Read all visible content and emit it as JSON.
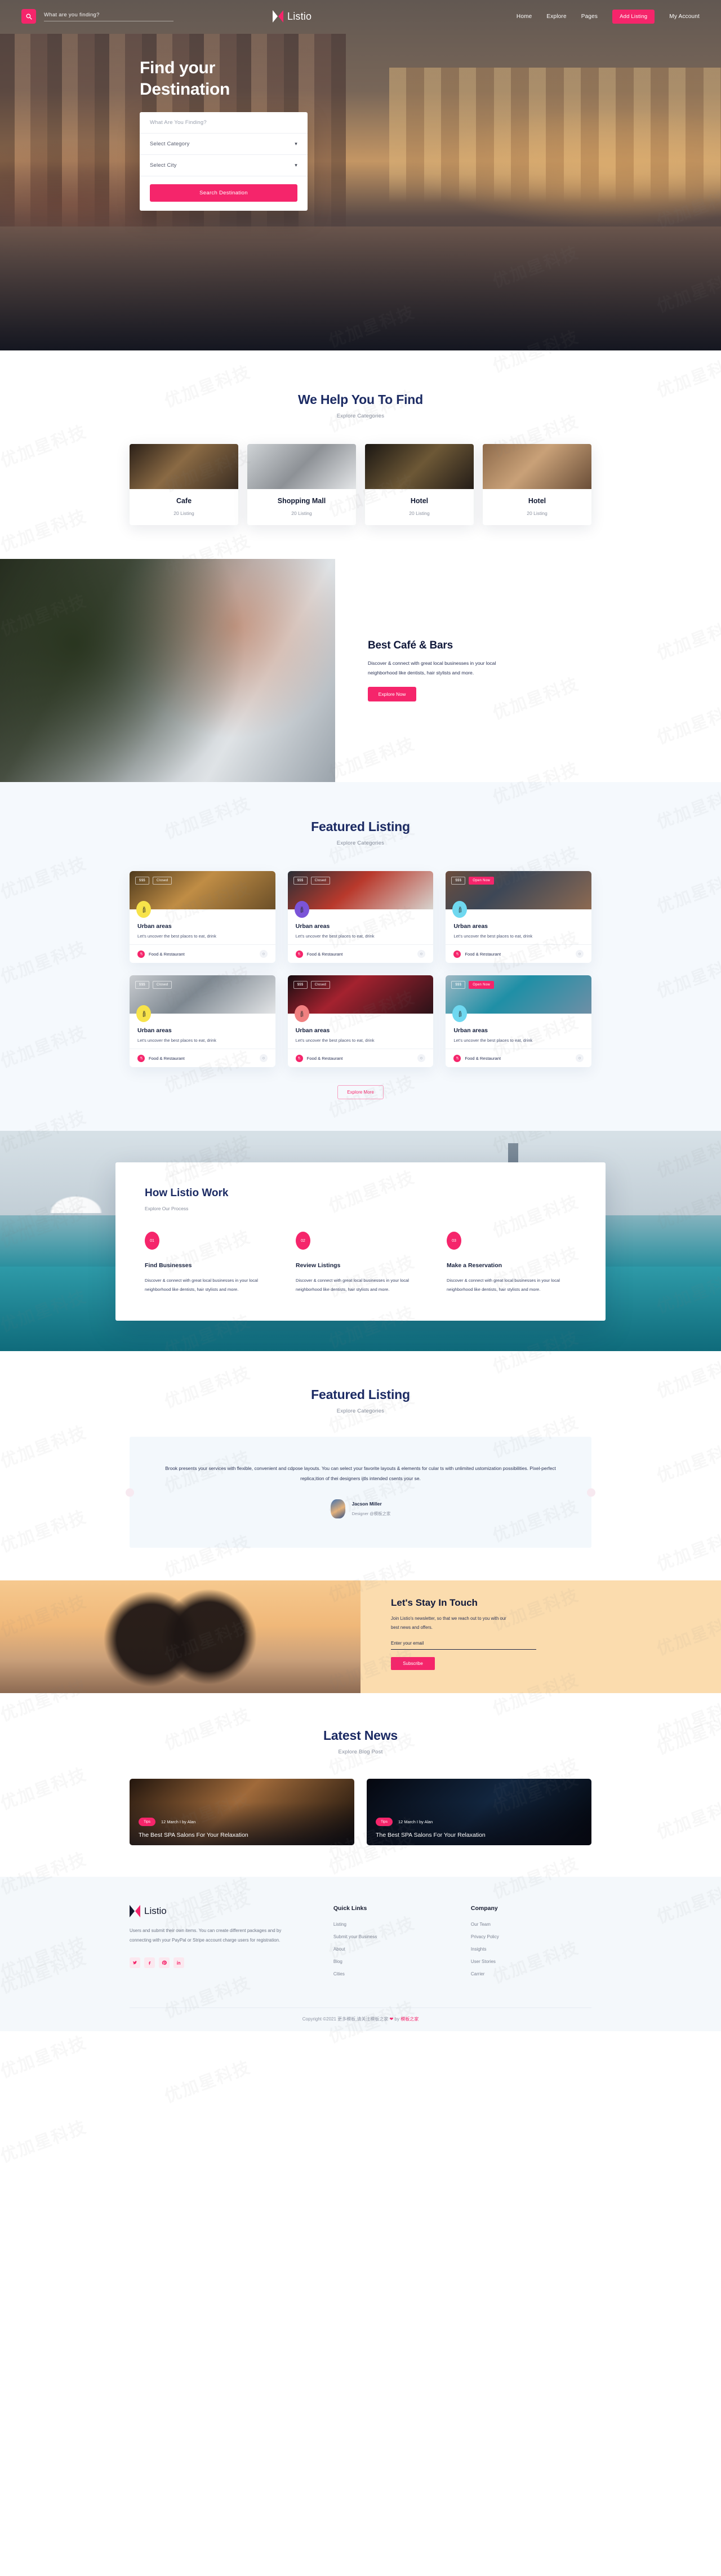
{
  "header": {
    "search_placeholder": "What are you finding?",
    "search_icon": "search-icon",
    "brand": "Listio",
    "nav": [
      {
        "label": "Home",
        "type": "link"
      },
      {
        "label": "Explore",
        "type": "link"
      },
      {
        "label": "Pages",
        "type": "link"
      },
      {
        "label": "Add Listing",
        "type": "cta"
      },
      {
        "label": "My Account",
        "type": "link"
      }
    ]
  },
  "hero": {
    "title_line1": "Find your",
    "title_line2": "Destination",
    "field_keyword": "What Are You Finding?",
    "field_category": "Select Category",
    "field_city": "Select City",
    "chevron": "⌄",
    "button": "Search Destination"
  },
  "categories": {
    "title": "We Help You To Find",
    "subtitle": "Explore Categories",
    "items": [
      {
        "name": "Cafe",
        "count": "20 Listing"
      },
      {
        "name": "Shopping Mall",
        "count": "20 Listing"
      },
      {
        "name": "Hotel",
        "count": "20 Listing"
      },
      {
        "name": "Hotel",
        "count": "20 Listing"
      }
    ]
  },
  "cafe": {
    "title": "Best Café & Bars",
    "paragraph": "Discover & connect with great local businesses in your local neighborhood like dentists, hair stylists and more.",
    "button": "Explore Now"
  },
  "featured": {
    "title": "Featured Listing",
    "subtitle": "Explore Categories",
    "explore_more": "Explore More",
    "items": [
      {
        "price": "$$$",
        "status": "Closed",
        "status_type": "closed",
        "badge_color": "#f7e34a",
        "title": "Urban areas",
        "desc": "Let's uncover the best places to eat, drink",
        "category": "Food & Restaurant"
      },
      {
        "price": "$$$",
        "status": "Closed",
        "status_type": "closed",
        "badge_color": "#7b54d8",
        "title": "Urban areas",
        "desc": "Let's uncover the best places to eat, drink",
        "category": "Food & Restaurant"
      },
      {
        "price": "$$$",
        "status": "Open Now",
        "status_type": "open",
        "badge_color": "#6fd8f0",
        "title": "Urban areas",
        "desc": "Let's uncover the best places to eat, drink",
        "category": "Food & Restaurant"
      },
      {
        "price": "$$$",
        "status": "Closed",
        "status_type": "closed",
        "badge_color": "#f7e34a",
        "title": "Urban areas",
        "desc": "Let's uncover the best places to eat, drink",
        "category": "Food & Restaurant"
      },
      {
        "price": "$$$",
        "status": "Closed",
        "status_type": "closed",
        "badge_color": "#f08080",
        "title": "Urban areas",
        "desc": "Let's uncover the best places to eat, drink",
        "category": "Food & Restaurant"
      },
      {
        "price": "$$$",
        "status": "Open Now",
        "status_type": "open",
        "badge_color": "#6fd8f0",
        "title": "Urban areas",
        "desc": "Let's uncover the best places to eat, drink",
        "category": "Food & Restaurant"
      }
    ]
  },
  "how": {
    "title": "How Listio Work",
    "subtitle": "Explore Our Process",
    "steps": [
      {
        "num": "01",
        "title": "Find Businesses",
        "desc": "Discover & connect with great local businesses in your local neighborhood like dentists, hair stylists and more."
      },
      {
        "num": "02",
        "title": "Review Listings",
        "desc": "Discover & connect with great local businesses in your local neighborhood like dentists, hair stylists and more."
      },
      {
        "num": "03",
        "title": "Make a Reservation",
        "desc": "Discover & connect with great local businesses in your local neighborhood like dentists, hair stylists and more."
      }
    ]
  },
  "testimonial": {
    "title": "Featured Listing",
    "subtitle": "Explore Categories",
    "quote": "Brook presents your services with flexible, convenient and cdpose layouts. You can select your favorite layouts & elements for cular ts with unlimited ustomization possibilities. Pixel-perfect replica;ition of thei designers ijtls intended csents your se.",
    "author": "Jacson Miller",
    "role": "Designer @模板之家"
  },
  "newsletter": {
    "title": "Let's Stay In Touch",
    "paragraph": "Join Listio's newsletter, so that we reach out to you with our best news and offers.",
    "placeholder": "Enter your email",
    "button": "Subscribe"
  },
  "blog": {
    "title": "Latest News",
    "subtitle": "Explore Blog Post",
    "posts": [
      {
        "tag": "Tips",
        "meta": "12 March I by Alan",
        "title": "The Best SPA Salons For Your Relaxation"
      },
      {
        "tag": "Tips",
        "meta": "12 March I by Alan",
        "title": "The Best SPA Salons For Your Relaxation"
      }
    ]
  },
  "footer": {
    "brand": "Listio",
    "about": "Users and submit their own items. You can create different packages and by connecting with your PayPal or Stripe account charge users for registration.",
    "socials": [
      "twitter-icon",
      "facebook-icon",
      "pinterest-icon",
      "linkedin-icon"
    ],
    "columns": [
      {
        "heading": "Quick Links",
        "links": [
          "Listing",
          "Submit your Business",
          "About",
          "Blog",
          "Cities"
        ]
      },
      {
        "heading": "Company",
        "links": [
          "Our Team",
          "Privacy Policy",
          "Insights",
          "User Stories",
          "Carrier"
        ]
      }
    ],
    "copyright_pre": "Copyright ©2021 ",
    "copyright_mid": "更多模板,请关注模板之家",
    "copyright_by": " by ",
    "copyright_link": "模板之家"
  },
  "colors": {
    "accent": "#f5256b",
    "heading": "#1b2a63",
    "featured_bg": "#f5f9fd",
    "newsletter_bg": "#fbdcae",
    "footer_bg": "#f4f8fb"
  },
  "watermark_text": "优加星科技"
}
